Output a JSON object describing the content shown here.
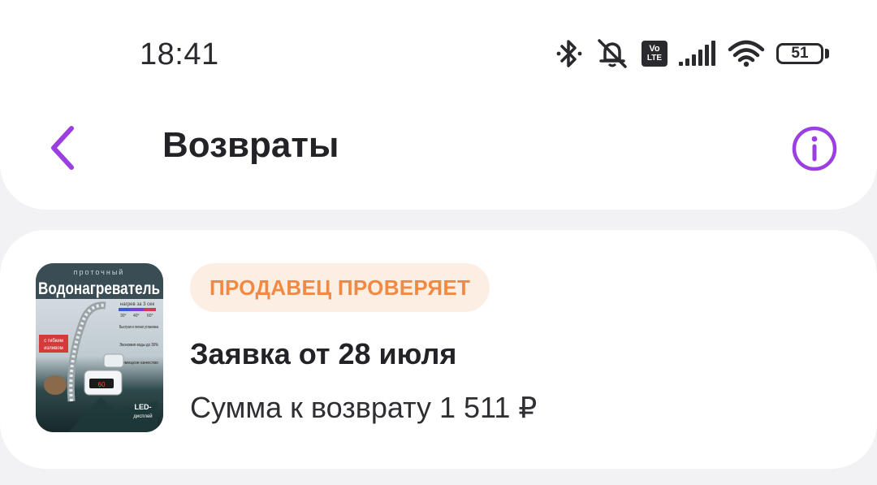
{
  "status_bar": {
    "time": "18:41",
    "battery": "51",
    "volte": "Vo",
    "lte": "LTE",
    "icons": [
      "bluetooth-icon",
      "mute-icon",
      "volte-icon",
      "signal-icon",
      "wifi-icon",
      "battery-icon"
    ]
  },
  "header": {
    "title": "Возвраты",
    "back_icon": "chevron-left-icon",
    "info_icon": "info-icon",
    "accent_color": "#9b3fe0"
  },
  "return_request": {
    "status": "ПРОДАВЕЦ ПРОВЕРЯЕТ",
    "status_color": "#f08a43",
    "status_bg": "#fdeee4",
    "title": "Заявка от 28 июля",
    "amount": "Сумма к возврату 1 511 ₽",
    "product_image": {
      "top_text": "проточный",
      "main_text": "Водонагреватель",
      "heat_text": "нагрев за 3 сек",
      "temps": [
        "30°",
        "40°",
        "60°"
      ],
      "features": [
        "Быстрая и легкая установка",
        "Экономия воды до 30%",
        "Немецкое качество"
      ],
      "hose_label_1": "с гибким",
      "hose_label_2": "изливом",
      "led_label_1": "LED-",
      "led_label_2": "дисплей",
      "display_value": "60"
    }
  }
}
